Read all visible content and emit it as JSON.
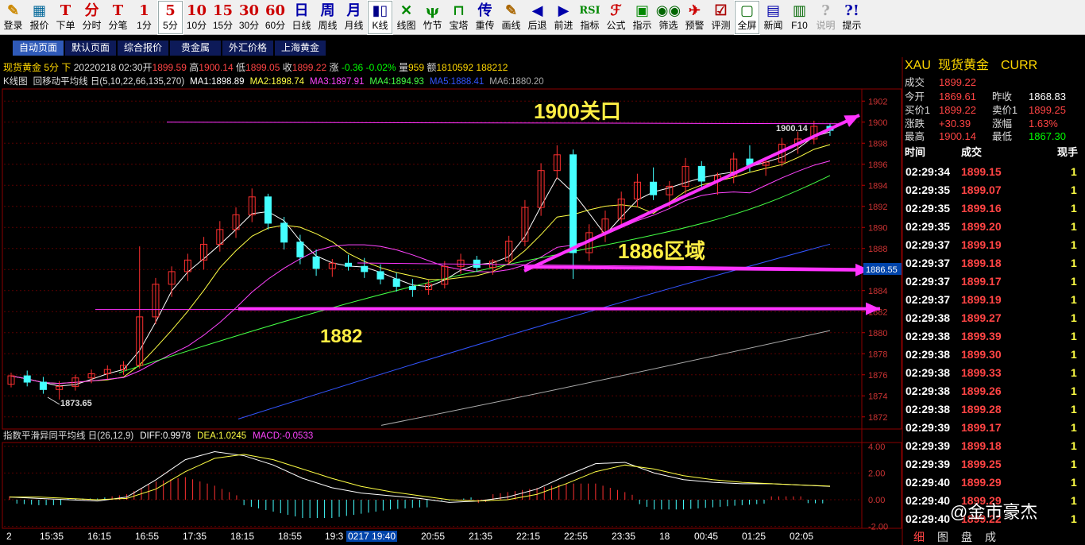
{
  "toolbar": [
    {
      "icon": "✎",
      "label": "登录",
      "color": "#c80",
      "name": "login"
    },
    {
      "icon": "▦",
      "label": "报价",
      "color": "#069",
      "name": "quote"
    },
    {
      "icon": "T",
      "label": "下单",
      "color": "#c00",
      "name": "order"
    },
    {
      "icon": "分",
      "label": "分时",
      "color": "#c00",
      "name": "timeshare"
    },
    {
      "icon": "T",
      "label": "分笔",
      "color": "#c00",
      "name": "tick"
    },
    {
      "icon": "1",
      "label": "1分",
      "color": "#c00",
      "name": "1min"
    },
    {
      "icon": "5",
      "label": "5分",
      "color": "#c00",
      "name": "5min",
      "selected": true
    },
    {
      "icon": "10",
      "label": "10分",
      "color": "#c00",
      "name": "10min"
    },
    {
      "icon": "15",
      "label": "15分",
      "color": "#c00",
      "name": "15min"
    },
    {
      "icon": "30",
      "label": "30分",
      "color": "#c00",
      "name": "30min"
    },
    {
      "icon": "60",
      "label": "60分",
      "color": "#c00",
      "name": "60min"
    },
    {
      "icon": "日",
      "label": "日线",
      "color": "#00a",
      "name": "daily"
    },
    {
      "icon": "周",
      "label": "周线",
      "color": "#00a",
      "name": "weekly"
    },
    {
      "icon": "月",
      "label": "月线",
      "color": "#00a",
      "name": "monthly"
    },
    {
      "icon": "▮▯",
      "label": "K线",
      "color": "#008",
      "name": "kline",
      "selected": true
    },
    {
      "icon": "✕",
      "label": "线图",
      "color": "#080",
      "name": "linechart"
    },
    {
      "icon": "ψ",
      "label": "竹节",
      "color": "#080",
      "name": "bamboo"
    },
    {
      "icon": "⊓",
      "label": "宝塔",
      "color": "#080",
      "name": "tower"
    },
    {
      "icon": "传",
      "label": "重传",
      "color": "#00a",
      "name": "reload"
    },
    {
      "icon": "✎",
      "label": "画线",
      "color": "#a60",
      "name": "draw"
    },
    {
      "icon": "◀",
      "label": "后退",
      "color": "#00a",
      "name": "back"
    },
    {
      "icon": "▶",
      "label": "前进",
      "color": "#00a",
      "name": "forward"
    },
    {
      "icon": "RSI",
      "label": "指标",
      "color": "#080",
      "name": "indicator"
    },
    {
      "icon": "ℱ",
      "label": "公式",
      "color": "#c00",
      "name": "formula"
    },
    {
      "icon": "▣",
      "label": "指示",
      "color": "#080",
      "name": "indicate"
    },
    {
      "icon": "◉◉",
      "label": "筛选",
      "color": "#060",
      "name": "filter"
    },
    {
      "icon": "✈",
      "label": "预警",
      "color": "#c00",
      "name": "alert"
    },
    {
      "icon": "☑",
      "label": "评测",
      "color": "#a00",
      "name": "evaluate"
    },
    {
      "icon": "▢",
      "label": "全屏",
      "color": "#060",
      "name": "fullscreen",
      "selected": true
    },
    {
      "icon": "▤",
      "label": "新闻",
      "color": "#00a",
      "name": "news"
    },
    {
      "icon": "▥",
      "label": "F10",
      "color": "#060",
      "name": "f10"
    },
    {
      "icon": "?",
      "label": "说明",
      "color": "#aaa",
      "name": "help-disabled",
      "disabled": true
    },
    {
      "icon": "?!",
      "label": "提示",
      "color": "#00a",
      "name": "hint"
    }
  ],
  "tabs": [
    "自动页面",
    "默认页面",
    "综合报价",
    "贵金属",
    "外汇价格",
    "上海黄金"
  ],
  "header": {
    "name": "现货黄金",
    "period": "5分",
    "direction": "下",
    "datetime": "20220218 02:30",
    "open_label": "开",
    "open": "1899.59",
    "high_label": "高",
    "high": "1900.14",
    "low_label": "低",
    "low": "1899.05",
    "close_label": "收",
    "close": "1899.22",
    "chg_label": "涨",
    "chg": "-0.36",
    "chgpct": "-0.02%",
    "vol_label": "量",
    "vol": "959",
    "amt_label": "额",
    "amt": "1810592",
    "extra": "188212"
  },
  "ma_header": [
    {
      "text": "K线图",
      "color": "#ddd"
    },
    {
      "text": "回移动平均线 日(5,10,22,66,135,270)",
      "color": "#ddd"
    },
    {
      "text": "MA1:1898.89",
      "color": "#ffffff"
    },
    {
      "text": "MA2:1898.74",
      "color": "#ffff44"
    },
    {
      "text": "MA3:1897.91",
      "color": "#ff44ff"
    },
    {
      "text": "MA4:1894.93",
      "color": "#44ff44"
    },
    {
      "text": "MA5:1888.41",
      "color": "#3355ff"
    },
    {
      "text": "MA6:1880.20",
      "color": "#aaaaaa"
    }
  ],
  "macd_header": [
    {
      "text": "指数平滑异同平均线 日(26,12,9)",
      "color": "#ddd"
    },
    {
      "text": "DIFF:0.9978",
      "color": "#ffffff"
    },
    {
      "text": "DEA:1.0245",
      "color": "#ffff44"
    },
    {
      "text": "MACD:-0.0533",
      "color": "#ff44ff"
    }
  ],
  "price_axis": [
    "1902",
    "1900",
    "1898",
    "1896",
    "1894",
    "1892",
    "1890",
    "1888",
    "1886",
    "1884",
    "1882",
    "1880",
    "1878",
    "1876",
    "1874",
    "1872"
  ],
  "macd_axis": [
    "4.00",
    "2.00",
    "0.00",
    "-2.00"
  ],
  "x_axis": [
    "2",
    "15:35",
    "16:15",
    "16:55",
    "17:35",
    "18:15",
    "18:55",
    "19:3",
    "0217 19:40",
    "20:55",
    "21:35",
    "22:15",
    "22:55",
    "23:35",
    "18",
    "00:45",
    "01:25",
    "02:05"
  ],
  "annotations": {
    "a1900": "1900关口",
    "a1886": "1886区域",
    "a1882": "1882",
    "low_mark": "1873.65",
    "high_mark": "1900.14",
    "last_price_tag": "1886.55"
  },
  "chart_data": {
    "type": "candlestick",
    "symbol": "现货黄金",
    "period": "5分",
    "y_range": [
      1871,
      1903
    ],
    "candles": [
      [
        1875.1,
        1876.2,
        1874.8,
        1875.9
      ],
      [
        1875.9,
        1876.4,
        1874.9,
        1875.3
      ],
      [
        1875.3,
        1875.8,
        1874.2,
        1874.6
      ],
      [
        1874.6,
        1875.4,
        1873.65,
        1874.9
      ],
      [
        1874.9,
        1876.0,
        1874.5,
        1875.7
      ],
      [
        1875.7,
        1876.5,
        1875.2,
        1876.1
      ],
      [
        1876.1,
        1876.9,
        1875.6,
        1876.5
      ],
      [
        1876.5,
        1877.3,
        1876.0,
        1876.9
      ],
      [
        1876.9,
        1888.2,
        1876.6,
        1881.5
      ],
      [
        1881.5,
        1885.2,
        1880.8,
        1884.6
      ],
      [
        1884.6,
        1886.3,
        1883.4,
        1885.8
      ],
      [
        1885.8,
        1887.5,
        1884.9,
        1886.9
      ],
      [
        1886.9,
        1889.1,
        1886.0,
        1888.4
      ],
      [
        1888.4,
        1890.6,
        1887.7,
        1889.8
      ],
      [
        1889.8,
        1891.9,
        1889.0,
        1891.2
      ],
      [
        1891.2,
        1893.7,
        1890.5,
        1892.9
      ],
      [
        1892.9,
        1893.2,
        1889.8,
        1890.4
      ],
      [
        1890.4,
        1891.0,
        1887.9,
        1888.6
      ],
      [
        1888.6,
        1889.3,
        1886.5,
        1887.2
      ],
      [
        1887.2,
        1887.9,
        1885.4,
        1886.1
      ],
      [
        1886.1,
        1887.0,
        1885.3,
        1886.6
      ],
      [
        1886.6,
        1887.4,
        1885.9,
        1886.3
      ],
      [
        1886.3,
        1887.1,
        1885.2,
        1885.8
      ],
      [
        1885.8,
        1886.5,
        1884.6,
        1885.1
      ],
      [
        1885.1,
        1885.7,
        1883.9,
        1884.4
      ],
      [
        1884.4,
        1885.1,
        1883.4,
        1884.1
      ],
      [
        1884.1,
        1885.0,
        1883.6,
        1884.6
      ],
      [
        1884.6,
        1886.8,
        1884.2,
        1886.3
      ],
      [
        1886.3,
        1887.5,
        1885.6,
        1886.9
      ],
      [
        1886.9,
        1887.3,
        1885.8,
        1886.2
      ],
      [
        1886.2,
        1887.0,
        1885.5,
        1886.8
      ],
      [
        1886.8,
        1889.2,
        1886.4,
        1888.7
      ],
      [
        1888.7,
        1892.6,
        1888.2,
        1891.9
      ],
      [
        1891.9,
        1896.1,
        1891.1,
        1895.4
      ],
      [
        1895.4,
        1897.8,
        1894.6,
        1896.9
      ],
      [
        1896.9,
        1897.4,
        1885.1,
        1887.6
      ],
      [
        1887.6,
        1890.3,
        1886.8,
        1889.5
      ],
      [
        1889.5,
        1891.6,
        1888.6,
        1890.8
      ],
      [
        1890.8,
        1893.4,
        1890.1,
        1892.7
      ],
      [
        1892.7,
        1895.1,
        1891.9,
        1894.3
      ],
      [
        1894.3,
        1895.7,
        1892.6,
        1893.1
      ],
      [
        1893.1,
        1894.4,
        1891.9,
        1893.9
      ],
      [
        1893.9,
        1896.6,
        1893.2,
        1895.8
      ],
      [
        1895.8,
        1896.3,
        1893.6,
        1894.4
      ],
      [
        1894.4,
        1895.2,
        1893.1,
        1894.9
      ],
      [
        1894.9,
        1897.1,
        1894.2,
        1896.5
      ],
      [
        1896.5,
        1897.8,
        1895.3,
        1895.9
      ],
      [
        1895.9,
        1896.7,
        1894.9,
        1896.2
      ],
      [
        1896.2,
        1898.5,
        1895.8,
        1897.9
      ],
      [
        1897.9,
        1899.1,
        1897.0,
        1898.4
      ],
      [
        1898.4,
        1900.14,
        1897.9,
        1899.6
      ],
      [
        1899.6,
        1899.9,
        1898.7,
        1899.22
      ]
    ],
    "macd": {
      "diff": [
        0.2,
        0.1,
        0.0,
        -0.1,
        0.2,
        1.5,
        3.0,
        3.6,
        3.3,
        2.6,
        1.6,
        0.9,
        0.5,
        0.3,
        0.1,
        -0.2,
        -0.1,
        0.2,
        0.8,
        1.8,
        2.7,
        2.8,
        2.0,
        1.5,
        1.3,
        1.2,
        1.2,
        1.1,
        1.0
      ],
      "dea": [
        0.2,
        0.2,
        0.1,
        0.0,
        0.1,
        0.8,
        2.1,
        3.1,
        3.4,
        3.0,
        2.3,
        1.6,
        1.0,
        0.6,
        0.3,
        0.0,
        -0.1,
        0.0,
        0.4,
        1.2,
        2.1,
        2.6,
        2.3,
        1.8,
        1.5,
        1.3,
        1.2,
        1.1,
        1.02
      ]
    },
    "ma_lines": [
      {
        "name": "MA4",
        "value": 1894.93,
        "color": "#44ff44"
      },
      {
        "name": "MA5",
        "value": 1888.41,
        "color": "#3355ff"
      },
      {
        "name": "MA6",
        "value": 1880.2,
        "color": "#aaaaaa"
      }
    ],
    "levels": [
      {
        "label": "1900关口",
        "value": 1900
      },
      {
        "label": "1886区域",
        "value": 1886.55
      },
      {
        "label": "1882",
        "value": 1882.2
      }
    ],
    "grid": "dotted horizontal"
  },
  "quote_panel": {
    "symbol": "XAU",
    "name": "现货黄金",
    "curr": "CURR",
    "rows": [
      {
        "l1": "成交",
        "v1": "1899.22",
        "l2": "",
        "v2": ""
      },
      {
        "l1": "今开",
        "v1": "1869.61",
        "l2": "昨收",
        "v2": "1868.83"
      },
      {
        "l1": "买价1",
        "v1": "1899.22",
        "l2": "卖价1",
        "v2": "1899.25"
      },
      {
        "l1": "涨跌",
        "v1": "+30.39",
        "l2": "涨幅",
        "v2": "1.63%"
      },
      {
        "l1": "最高",
        "v1": "1900.14",
        "l2": "最低",
        "v2": "1867.30"
      }
    ],
    "tick_headers": [
      "时间",
      "成交",
      "现手"
    ],
    "ticks": [
      {
        "t": "02:29:34",
        "p": "1899.15",
        "v": "1"
      },
      {
        "t": "02:29:35",
        "p": "1899.07",
        "v": "1"
      },
      {
        "t": "02:29:35",
        "p": "1899.16",
        "v": "1"
      },
      {
        "t": "02:29:35",
        "p": "1899.20",
        "v": "1"
      },
      {
        "t": "02:29:37",
        "p": "1899.19",
        "v": "1"
      },
      {
        "t": "02:29:37",
        "p": "1899.18",
        "v": "1"
      },
      {
        "t": "02:29:37",
        "p": "1899.17",
        "v": "1"
      },
      {
        "t": "02:29:37",
        "p": "1899.19",
        "v": "1"
      },
      {
        "t": "02:29:38",
        "p": "1899.27",
        "v": "1"
      },
      {
        "t": "02:29:38",
        "p": "1899.39",
        "v": "1"
      },
      {
        "t": "02:29:38",
        "p": "1899.30",
        "v": "1"
      },
      {
        "t": "02:29:38",
        "p": "1899.33",
        "v": "1"
      },
      {
        "t": "02:29:38",
        "p": "1899.26",
        "v": "1"
      },
      {
        "t": "02:29:38",
        "p": "1899.28",
        "v": "1"
      },
      {
        "t": "02:29:39",
        "p": "1899.17",
        "v": "1"
      },
      {
        "t": "02:29:39",
        "p": "1899.18",
        "v": "1"
      },
      {
        "t": "02:29:39",
        "p": "1899.25",
        "v": "1"
      },
      {
        "t": "02:29:40",
        "p": "1899.29",
        "v": "1"
      },
      {
        "t": "02:29:40",
        "p": "1899.29",
        "v": "1"
      },
      {
        "t": "02:29:40",
        "p": "1899.22",
        "v": "1"
      }
    ],
    "bottom_tabs": [
      "细",
      "图",
      "盘",
      "成"
    ]
  },
  "watermark": "@金市豪杰"
}
